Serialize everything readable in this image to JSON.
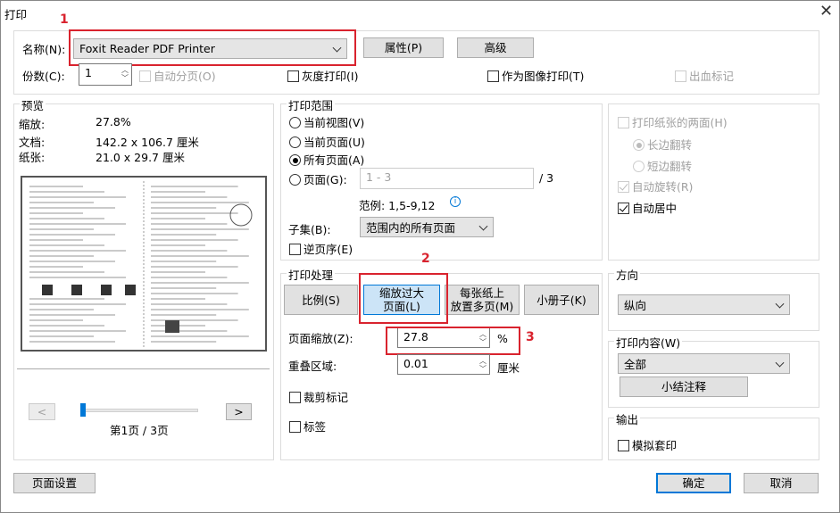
{
  "window": {
    "title": "打印",
    "close_icon": "close-icon"
  },
  "printer": {
    "name_label": "名称(N):",
    "name_value": "Foxit Reader PDF Printer",
    "properties": "属性(P)",
    "advanced": "高级",
    "copies_label": "份数(C):",
    "copies_value": "1",
    "collate": "自动分页(O)",
    "grayscale": "灰度打印(I)",
    "print_as_image": "作为图像打印(T)",
    "bleed_marks": "出血标记"
  },
  "preview": {
    "title": "预览",
    "rows": [
      {
        "label": "缩放:",
        "value": "27.8%"
      },
      {
        "label": "文档:",
        "value": "142.2 x 106.7 厘米"
      },
      {
        "label": "纸张:",
        "value": "21.0 x 29.7 厘米"
      }
    ],
    "prev": "<",
    "next": ">",
    "page_indicator": "第1页 / 3页",
    "slider_fraction": 0
  },
  "range": {
    "title": "打印范围",
    "options": [
      "当前视图(V)",
      "当前页面(U)",
      "所有页面(A)",
      "页面(G):"
    ],
    "pages_placeholder": "1 - 3",
    "total": "/ 3",
    "example": "范例: 1,5-9,12",
    "subset_label": "子集(B):",
    "subset_value": "范围内的所有页面",
    "reverse": "逆页序(E)"
  },
  "duplex": {
    "both_sides": "打印纸张的两面(H)",
    "long_edge": "长边翻转",
    "short_edge": "短边翻转",
    "auto_rotate": "自动旋转(R)",
    "auto_center": "自动居中"
  },
  "handling": {
    "title": "打印处理",
    "buttons": [
      "比例(S)",
      "缩放过大\n页面(L)",
      "每张纸上\n放置多页(M)",
      "小册子(K)"
    ],
    "zoom_label": "页面缩放(Z):",
    "zoom_value": "27.8",
    "zoom_unit": "%",
    "overlap_label": "重叠区域:",
    "overlap_value": "0.01",
    "overlap_unit": "厘米",
    "crop_marks": "裁剪标记",
    "labels": "标签"
  },
  "orientation": {
    "title": "方向",
    "value": "纵向"
  },
  "content": {
    "title": "打印内容(W)",
    "value": "全部",
    "summary": "小结注释"
  },
  "output": {
    "title": "输出",
    "simulate": "模拟套印"
  },
  "footer": {
    "page_setup": "页面设置",
    "ok": "确定",
    "cancel": "取消"
  },
  "annotations": [
    "1",
    "2",
    "3"
  ],
  "colors": {
    "highlight": "#d9232e",
    "selected_bg": "#cce4f7",
    "selected_border": "#0078d7"
  }
}
